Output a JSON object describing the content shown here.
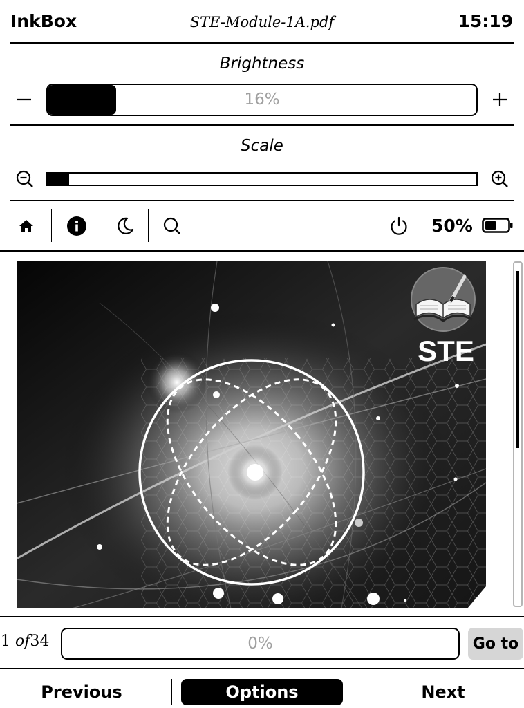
{
  "header": {
    "app_title": "InkBox",
    "document_title": "STE-Module-1A.pdf",
    "clock": "15:19"
  },
  "brightness": {
    "label": "Brightness",
    "value_text": "16%",
    "value": 0.16,
    "decrease_icon": "minus-icon",
    "increase_icon": "plus-icon"
  },
  "scale": {
    "label": "Scale",
    "value": 0.05,
    "zoom_out_icon": "zoom-out-icon",
    "zoom_in_icon": "zoom-in-icon"
  },
  "toolbar": {
    "left_icons": [
      "home-icon",
      "info-icon",
      "night-mode-icon",
      "search-icon"
    ],
    "power_icon": "power-icon",
    "battery_text": "50%",
    "battery_level": 0.5,
    "battery_icon": "battery-icon"
  },
  "page": {
    "logo_text": "STE",
    "scroll_position": 0.0
  },
  "footer": {
    "current_page": "1",
    "of_label": "of",
    "total_pages": "34",
    "progress_text": "0%",
    "progress_value": 0.0,
    "goto_label": "Go to",
    "previous_label": "Previous",
    "options_label": "Options",
    "next_label": "Next"
  },
  "colors": {
    "text": "#000000",
    "background": "#ffffff",
    "muted_text": "#a0a0a0",
    "button_gray": "#d6d6d6",
    "scrollbar_border": "#b5b5b5"
  }
}
